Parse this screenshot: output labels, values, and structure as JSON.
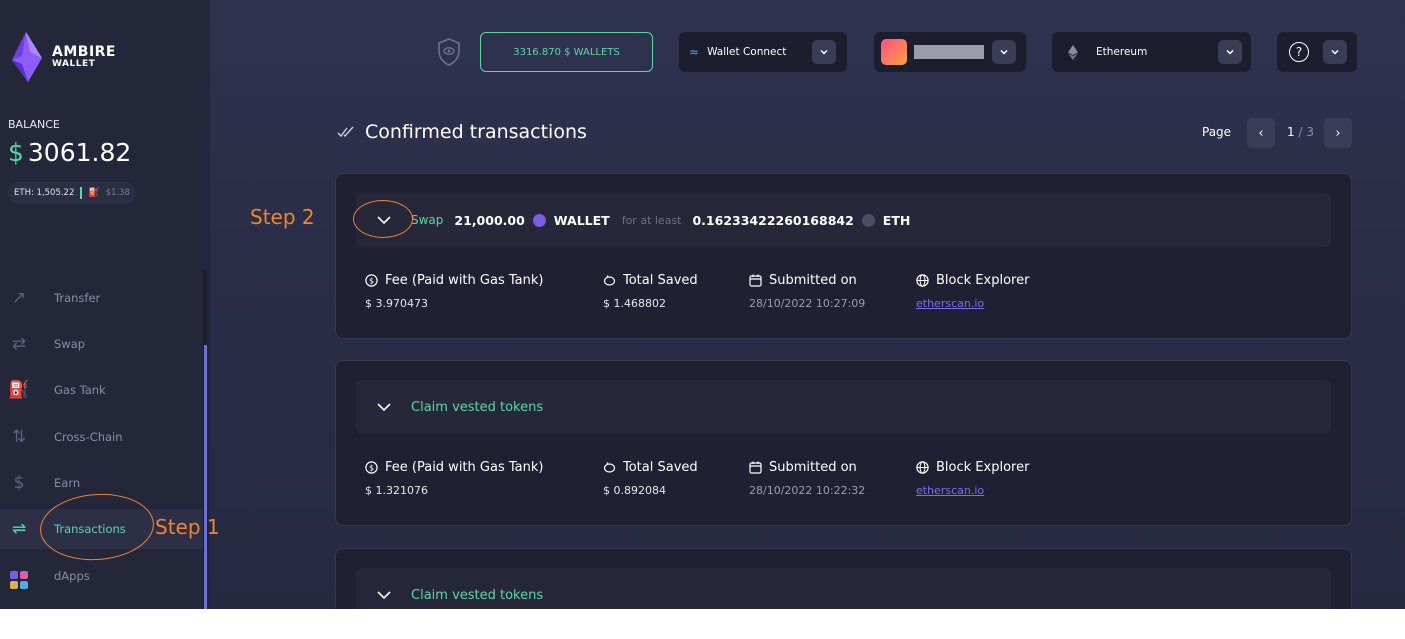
{
  "brand": {
    "line1": "AMBIRE",
    "line2": "WALLET"
  },
  "balance": {
    "label": "BALANCE",
    "currency": "$",
    "amount": "3061.82",
    "eth": "ETH: 1,505.22",
    "gas": "$1.38"
  },
  "nav": [
    {
      "label": "Transfer",
      "icon": "transfer-icon"
    },
    {
      "label": "Swap",
      "icon": "swap-icon"
    },
    {
      "label": "Gas Tank",
      "icon": "gas-tank-icon"
    },
    {
      "label": "Cross-Chain",
      "icon": "cross-chain-icon"
    },
    {
      "label": "Earn",
      "icon": "earn-icon"
    },
    {
      "label": "Transactions",
      "icon": "transactions-icon",
      "active": true
    },
    {
      "label": "dApps",
      "icon": "dapps-icon"
    }
  ],
  "topbar": {
    "wallets": "3316.870  $ WALLETS",
    "wallet_connect": "Wallet Connect",
    "network": "Ethereum"
  },
  "header": {
    "title": "Confirmed transactions",
    "page_label": "Page",
    "page_current": "1",
    "page_total": "/ 3"
  },
  "transactions": [
    {
      "action": "Swap",
      "amount": "21,000.00",
      "token": "WALLET",
      "connector": "for at least",
      "amount_out": "0.16233422260168842",
      "token_out": "ETH",
      "fee_label": "Fee (Paid with Gas Tank)",
      "fee": "$ 3.970473",
      "saved_label": "Total Saved",
      "saved": "$ 1.468802",
      "submitted_label": "Submitted on",
      "submitted": "28/10/2022 10:27:09",
      "explorer_label": "Block Explorer",
      "explorer": "etherscan.io"
    },
    {
      "action": "Claim vested tokens",
      "fee_label": "Fee (Paid with Gas Tank)",
      "fee": "$ 1.321076",
      "saved_label": "Total Saved",
      "saved": "$ 0.892084",
      "submitted_label": "Submitted on",
      "submitted": "28/10/2022 10:22:32",
      "explorer_label": "Block Explorer",
      "explorer": "etherscan.io"
    },
    {
      "action": "Claim vested tokens"
    }
  ],
  "annotations": {
    "step1": "Step 1",
    "step2": "Step 2"
  },
  "colors": {
    "accent": "#57d9a3",
    "annotation": "#f0852f",
    "link": "#7a6df0"
  }
}
